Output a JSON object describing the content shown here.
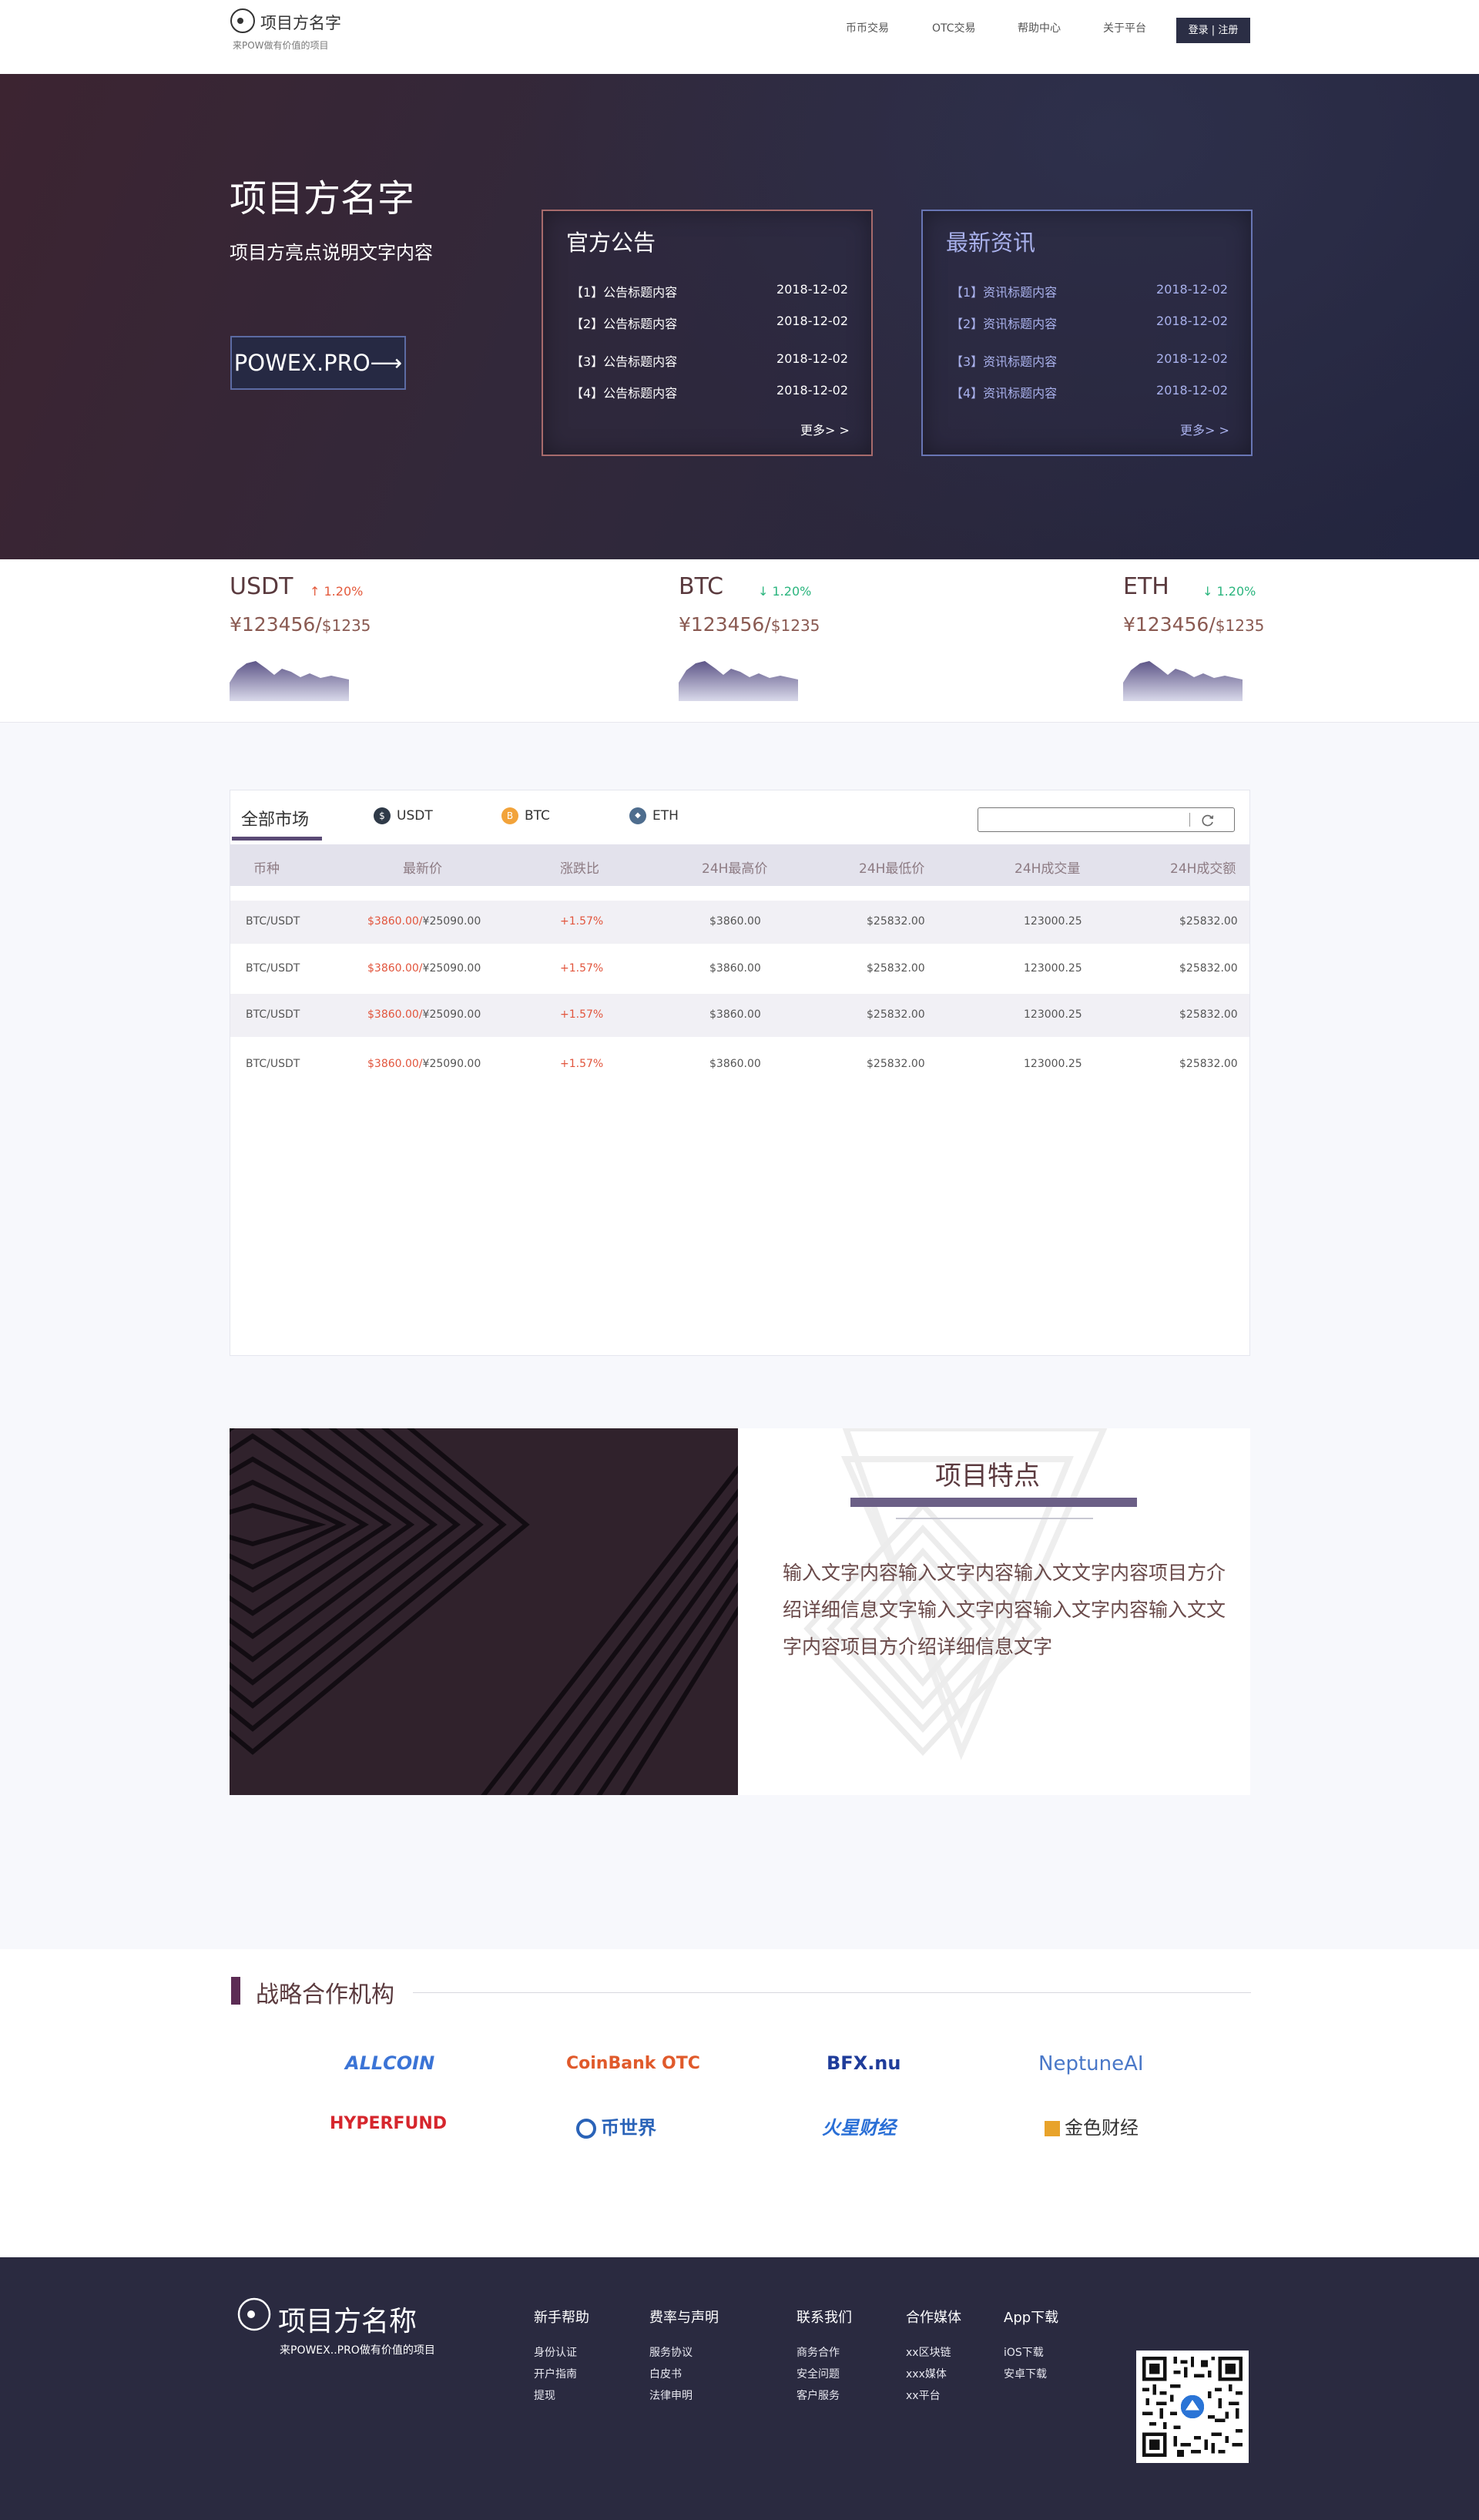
{
  "header": {
    "logo_title": "项目方名字",
    "logo_sub": "来POW做有价值的项目",
    "nav": [
      "币币交易",
      "OTC交易",
      "帮助中心",
      "关于平台"
    ],
    "login_label": "登录 | 注册"
  },
  "hero": {
    "title": "项目方名字",
    "subtitle": "项目方亮点说明文字内容",
    "button": "POWEX.PRO⟶",
    "announcements": {
      "title": "官方公告",
      "items": [
        {
          "title": "【1】公告标题内容",
          "date": "2018-12-02"
        },
        {
          "title": "【2】公告标题内容",
          "date": "2018-12-02"
        },
        {
          "title": "【3】公告标题内容",
          "date": "2018-12-02"
        },
        {
          "title": "【4】公告标题内容",
          "date": "2018-12-02"
        }
      ],
      "more": "更多> >"
    },
    "news": {
      "title": "最新资讯",
      "items": [
        {
          "title": "【1】资讯标题内容",
          "date": "2018-12-02"
        },
        {
          "title": "【2】资讯标题内容",
          "date": "2018-12-02"
        },
        {
          "title": "【3】资讯标题内容",
          "date": "2018-12-02"
        },
        {
          "title": "【4】资讯标题内容",
          "date": "2018-12-02"
        }
      ],
      "more": "更多> >"
    }
  },
  "tickers": [
    {
      "symbol": "USDT",
      "change": "↑ 1.20%",
      "direction": "up",
      "price": "¥123456/",
      "usd": "$1235"
    },
    {
      "symbol": "BTC",
      "change": "↓ 1.20%",
      "direction": "down",
      "price": "¥123456/",
      "usd": "$1235"
    },
    {
      "symbol": "ETH",
      "change": "↓ 1.20%",
      "direction": "down",
      "price": "¥123456/",
      "usd": "$1235"
    }
  ],
  "market": {
    "tabs": [
      {
        "label": "全部市场",
        "icon": ""
      },
      {
        "label": "USDT",
        "icon": "usdt-icon",
        "glyph": "$",
        "color": "#2f3a48"
      },
      {
        "label": "BTC",
        "icon": "btc-icon",
        "glyph": "B",
        "color": "#f2a33a"
      },
      {
        "label": "ETH",
        "icon": "eth-icon",
        "glyph": "◆",
        "color": "#4e6d8e"
      }
    ],
    "search_placeholder": "",
    "columns": [
      "币种",
      "最新价",
      "涨跌比",
      "24H最高价",
      "24H最低价",
      "24H成交量",
      "24H成交额"
    ],
    "rows": [
      {
        "pair": "BTC/USDT",
        "price_usd": "$3860.00/",
        "price_cny": "¥25090.00",
        "change": "+1.57%",
        "high": "$3860.00",
        "low": "$25832.00",
        "volume": "123000.25",
        "amount": "$25832.00"
      },
      {
        "pair": "BTC/USDT",
        "price_usd": "$3860.00/",
        "price_cny": "¥25090.00",
        "change": "+1.57%",
        "high": "$3860.00",
        "low": "$25832.00",
        "volume": "123000.25",
        "amount": "$25832.00"
      },
      {
        "pair": "BTC/USDT",
        "price_usd": "$3860.00/",
        "price_cny": "¥25090.00",
        "change": "+1.57%",
        "high": "$3860.00",
        "low": "$25832.00",
        "volume": "123000.25",
        "amount": "$25832.00"
      },
      {
        "pair": "BTC/USDT",
        "price_usd": "$3860.00/",
        "price_cny": "¥25090.00",
        "change": "+1.57%",
        "high": "$3860.00",
        "low": "$25832.00",
        "volume": "123000.25",
        "amount": "$25832.00"
      }
    ]
  },
  "features": {
    "title": "项目特点",
    "text": "输入文字内容输入文字内容输入文文字内容项目方介绍详细信息文字输入文字内容输入文字内容输入文文字内容项目方介绍详细信息文字"
  },
  "partners": {
    "title": "战略合作机构",
    "logos": [
      {
        "name": "ALLCOIN",
        "color": "#3b74d6"
      },
      {
        "name": "CoinBank OTC",
        "color": "#e05a2b"
      },
      {
        "name": "BFX.nu",
        "color": "#1f3c9a"
      },
      {
        "name": "NeptuneAI",
        "color": "#4a78c8"
      },
      {
        "name": "HYPERFUND",
        "color": "#d6262d"
      },
      {
        "name": "币世界",
        "color": "#2a63b8"
      },
      {
        "name": "火星财经",
        "color": "#2a6fd6"
      },
      {
        "name": "金色财经",
        "color": "#333333"
      }
    ]
  },
  "footer": {
    "title": "项目方名称",
    "sub": "来POWEX..PRO做有价值的项目",
    "columns": [
      {
        "title": "新手帮助",
        "links": [
          "身份认证",
          "开户指南",
          "提现"
        ]
      },
      {
        "title": "费率与声明",
        "links": [
          "服务协议",
          "白皮书",
          "法律申明"
        ]
      },
      {
        "title": "联系我们",
        "links": [
          "商务合作",
          "安全问题",
          "客户服务"
        ]
      },
      {
        "title": "合作媒体",
        "links": [
          "xx区块链",
          "xxx媒体",
          "xx平台"
        ]
      },
      {
        "title": "App下载",
        "links": [
          "iOS下载",
          "安卓下载"
        ]
      }
    ]
  }
}
